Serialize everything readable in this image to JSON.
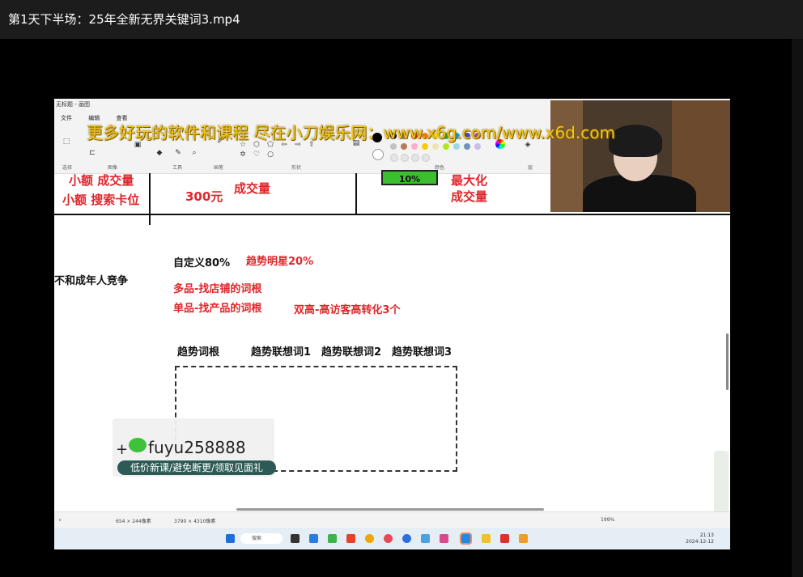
{
  "window": {
    "title": "第1天下半场：25年全新无界关键词3.mp4"
  },
  "paint": {
    "app_title": "无标题 - 画图",
    "menu": [
      "文件",
      "编辑",
      "查看"
    ],
    "groups": [
      "选择",
      "图像",
      "工具",
      "画笔",
      "形状",
      "颜色",
      "层"
    ]
  },
  "watermark": "更多好玩的软件和课程 尽在小刀娱乐网：www.x6g.com/www.x6d.com",
  "canvas": {
    "top_left": [
      "小额  成交量",
      "小额  搜索卡位"
    ],
    "top_mid": [
      "300元",
      "成交量"
    ],
    "top_right": [
      "最大化",
      "成交量"
    ],
    "progress_label": "10%",
    "progress_value": 0.1,
    "left_cut": "不和成年人竞争",
    "custom": "自定义80%",
    "trend_star": "趋势明星20%",
    "multi": "多品-找店铺的词根",
    "single": "单品-找产品的词根",
    "double_high": "双高-高访客高转化3个",
    "headers": [
      "趋势词根",
      "趋势联想词1",
      "趋势联想词2",
      "趋势联想词3"
    ]
  },
  "promo": {
    "id": "fuyu258888",
    "slogan": "低价新课/避免断更/领取见面礼"
  },
  "statusbar": {
    "selection": "654 × 244像素",
    "size": "3790 × 4310像素",
    "zoom": "199%"
  },
  "taskbar": {
    "search": "搜索",
    "time": "21:13",
    "date": "2024-12-12"
  },
  "colors": {
    "accent_red": "#e0262b",
    "green": "#3cbf2f",
    "watermark": "#f5c518"
  }
}
